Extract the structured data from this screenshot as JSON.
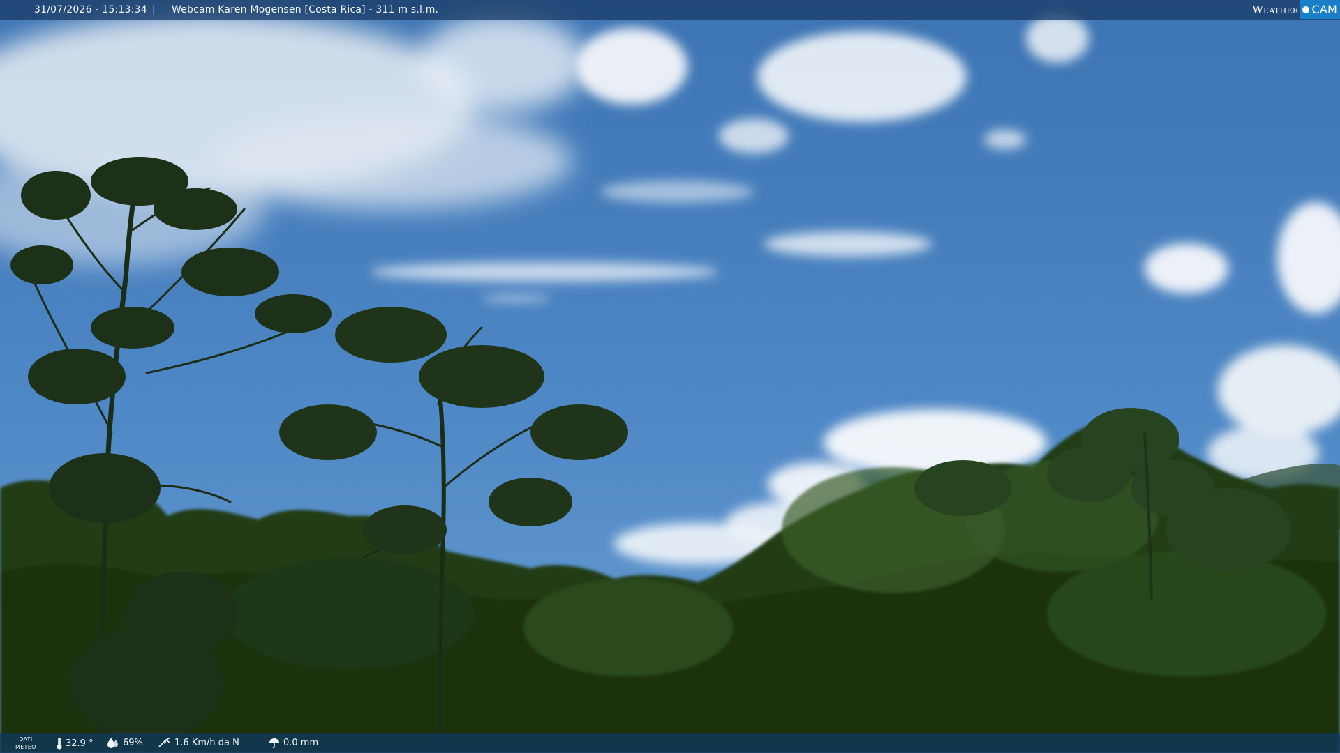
{
  "header": {
    "timestamp": "31/07/2026 - 15:13:34",
    "separator": "|",
    "title": "Webcam Karen Mogensen [Costa Rica] - 311 m s.l.m."
  },
  "brand": {
    "weather": "Weather",
    "cam": "CAM"
  },
  "weather_bar": {
    "label_line1": "DATI",
    "label_line2": "METEO",
    "temperature": "32.9 °",
    "humidity": "69%",
    "wind": "1.6 Km/h da N",
    "rain": "0.0 mm"
  },
  "icons": {
    "temperature": "thermometer-icon",
    "humidity": "humidity-icon",
    "wind": "wind-icon",
    "rain": "rain-gauge-icon"
  },
  "colors": {
    "sky_top": "#3f78b8",
    "sky_horizon": "#5d95cf",
    "foliage_dark": "#15260f",
    "foliage_mid": "#2a4a1d",
    "bar_top": "#1a3c68",
    "bar_bottom": "#10385c",
    "brand_accent": "#1a7fc9"
  }
}
